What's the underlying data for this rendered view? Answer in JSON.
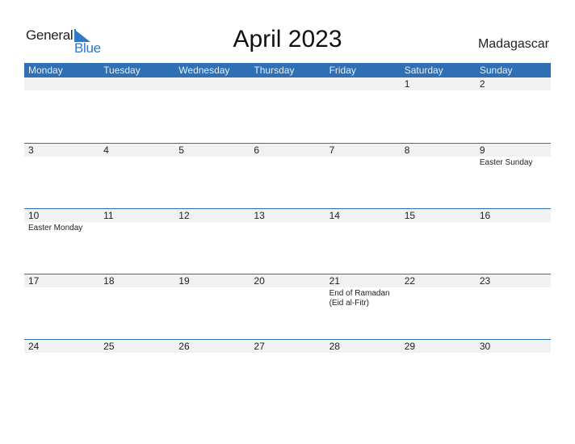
{
  "logo": {
    "line1": "General",
    "line2": "Blue"
  },
  "title": "April 2023",
  "country": "Madagascar",
  "colors": {
    "accent": "#2e70b3",
    "row_bg": "#f1f1f1"
  },
  "weekdays": [
    "Monday",
    "Tuesday",
    "Wednesday",
    "Thursday",
    "Friday",
    "Saturday",
    "Sunday"
  ],
  "weeks": [
    {
      "days": [
        "",
        "",
        "",
        "",
        "",
        "1",
        "2"
      ],
      "events": [
        "",
        "",
        "",
        "",
        "",
        "",
        ""
      ]
    },
    {
      "days": [
        "3",
        "4",
        "5",
        "6",
        "7",
        "8",
        "9"
      ],
      "events": [
        "",
        "",
        "",
        "",
        "",
        "",
        "Easter Sunday"
      ]
    },
    {
      "days": [
        "10",
        "11",
        "12",
        "13",
        "14",
        "15",
        "16"
      ],
      "events": [
        "Easter Monday",
        "",
        "",
        "",
        "",
        "",
        ""
      ]
    },
    {
      "days": [
        "17",
        "18",
        "19",
        "20",
        "21",
        "22",
        "23"
      ],
      "events": [
        "",
        "",
        "",
        "",
        "End of Ramadan (Eid al-Fitr)",
        "",
        ""
      ]
    },
    {
      "days": [
        "24",
        "25",
        "26",
        "27",
        "28",
        "29",
        "30"
      ],
      "events": [
        "",
        "",
        "",
        "",
        "",
        "",
        ""
      ]
    }
  ]
}
